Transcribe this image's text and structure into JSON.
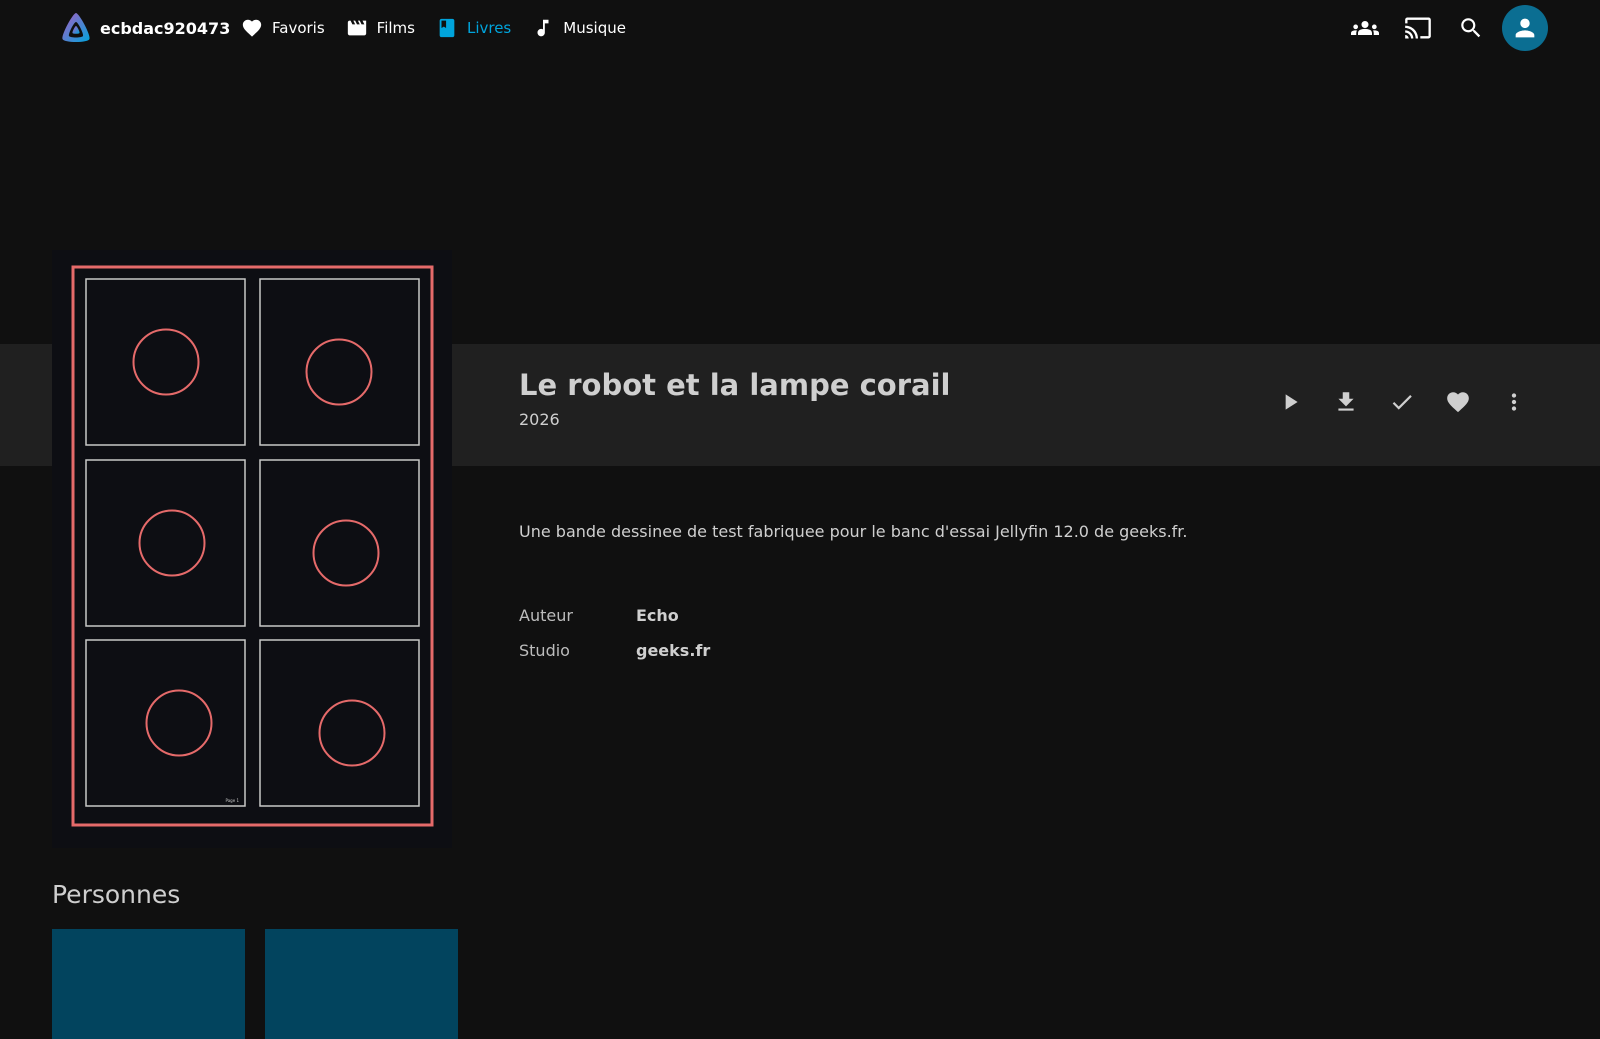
{
  "header": {
    "server_name": "ecbdac920473",
    "nav": [
      {
        "label": "Favoris",
        "icon": "heart-icon",
        "active": false
      },
      {
        "label": "Films",
        "icon": "clapperboard-icon",
        "active": false
      },
      {
        "label": "Livres",
        "icon": "book-icon",
        "active": true
      },
      {
        "label": "Musique",
        "icon": "music-note-icon",
        "active": false
      }
    ],
    "right_icons": [
      "people-icon",
      "cast-icon",
      "search-icon",
      "user-icon"
    ]
  },
  "item": {
    "title": "Le robot et la lampe corail",
    "year": "2026",
    "overview": "Une bande dessinee de test fabriquee pour le banc d'essai Jellyfin 12.0 de geeks.fr.",
    "actions": [
      "play-icon",
      "download-icon",
      "check-icon",
      "heart-icon",
      "more-vert-icon"
    ],
    "metadata": [
      {
        "key": "Auteur",
        "value": "Echo"
      },
      {
        "key": "Studio",
        "value": "geeks.fr"
      }
    ],
    "cover_page_label": "Page 1"
  },
  "people": {
    "section_title": "Personnes"
  },
  "colors": {
    "background": "#101010",
    "band": "#202020",
    "accent": "#00a4dc",
    "avatar": "#0b6e92",
    "person_card": "#02445e",
    "cover_frame": "#e56a6a"
  }
}
